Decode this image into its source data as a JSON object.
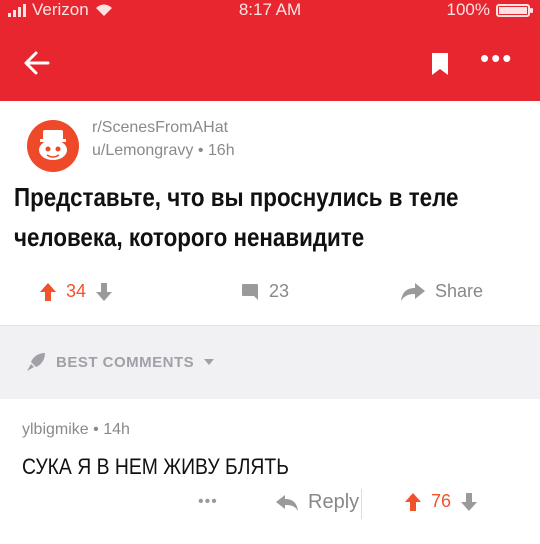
{
  "status_bar": {
    "carrier": "Verizon",
    "time": "8:17 AM",
    "battery": "100%"
  },
  "post": {
    "subreddit": "r/ScenesFromAHat",
    "author": "u/Lemongravy",
    "age": "16h",
    "title_line1": "Представьте, что вы проснулись в теле",
    "title_line2": "человека, которого ненавидите",
    "score": "34",
    "comments": "23",
    "share": "Share"
  },
  "sort": {
    "label": "BEST COMMENTS"
  },
  "comment": {
    "author": "ylbigmike",
    "age": "14h",
    "body": "СУКА Я В НЕМ ЖИВУ БЛЯТЬ",
    "more": "•••",
    "reply": "Reply",
    "score": "76"
  },
  "colors": {
    "brand": "#e8262f",
    "upvote": "#f0522b",
    "muted": "#8a8a8a"
  }
}
